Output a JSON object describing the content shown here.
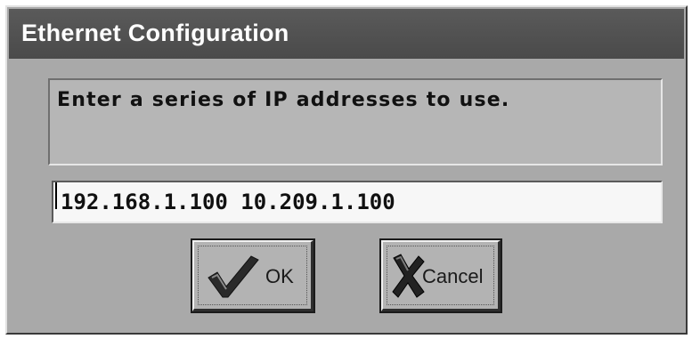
{
  "window": {
    "title": "Ethernet Configuration"
  },
  "dialog": {
    "message": "Enter a series of IP addresses to use.",
    "ip_field": {
      "value": "192.168.1.100 10.209.1.100"
    },
    "buttons": {
      "ok": {
        "label": "OK",
        "icon": "checkmark-icon"
      },
      "cancel": {
        "label": "Cancel",
        "icon": "x-icon"
      }
    }
  }
}
